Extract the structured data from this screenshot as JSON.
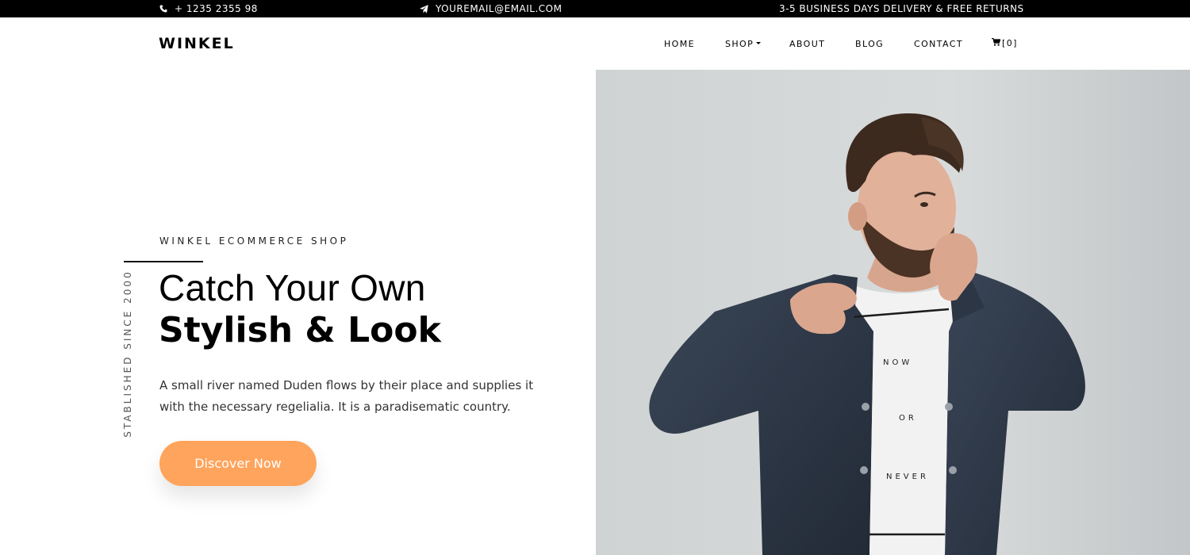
{
  "topbar": {
    "phone": "+ 1235 2355 98",
    "email": "YOUREMAIL@EMAIL.COM",
    "delivery": "3-5 BUSINESS DAYS DELIVERY & FREE RETURNS",
    "phone_icon": "phone-icon",
    "email_icon": "paper-plane-icon"
  },
  "brand": "WINKEL",
  "nav": {
    "home": "HOME",
    "shop": "SHOP",
    "about": "ABOUT",
    "blog": "BLOG",
    "contact": "CONTACT",
    "cart_count": "[0]",
    "cart_icon": "cart-icon",
    "dropdown_icon": "caret-down-icon"
  },
  "hero": {
    "vertical_text": "STABLISHED SINCE 2000",
    "subheading": "WINKEL ECOMMERCE SHOP",
    "title_line1": "Catch Your Own",
    "title_line2": "Stylish & Look",
    "description": "A small river named Duden flows by their place and supplies it with the necessary regelialia. It is a paradisematic country.",
    "button_label": "Discover Now",
    "shirt_text": [
      "NOW",
      "OR",
      "NEVER"
    ]
  },
  "colors": {
    "accent": "#ffa45c",
    "topbar_bg": "#000000",
    "text": "#000000"
  }
}
